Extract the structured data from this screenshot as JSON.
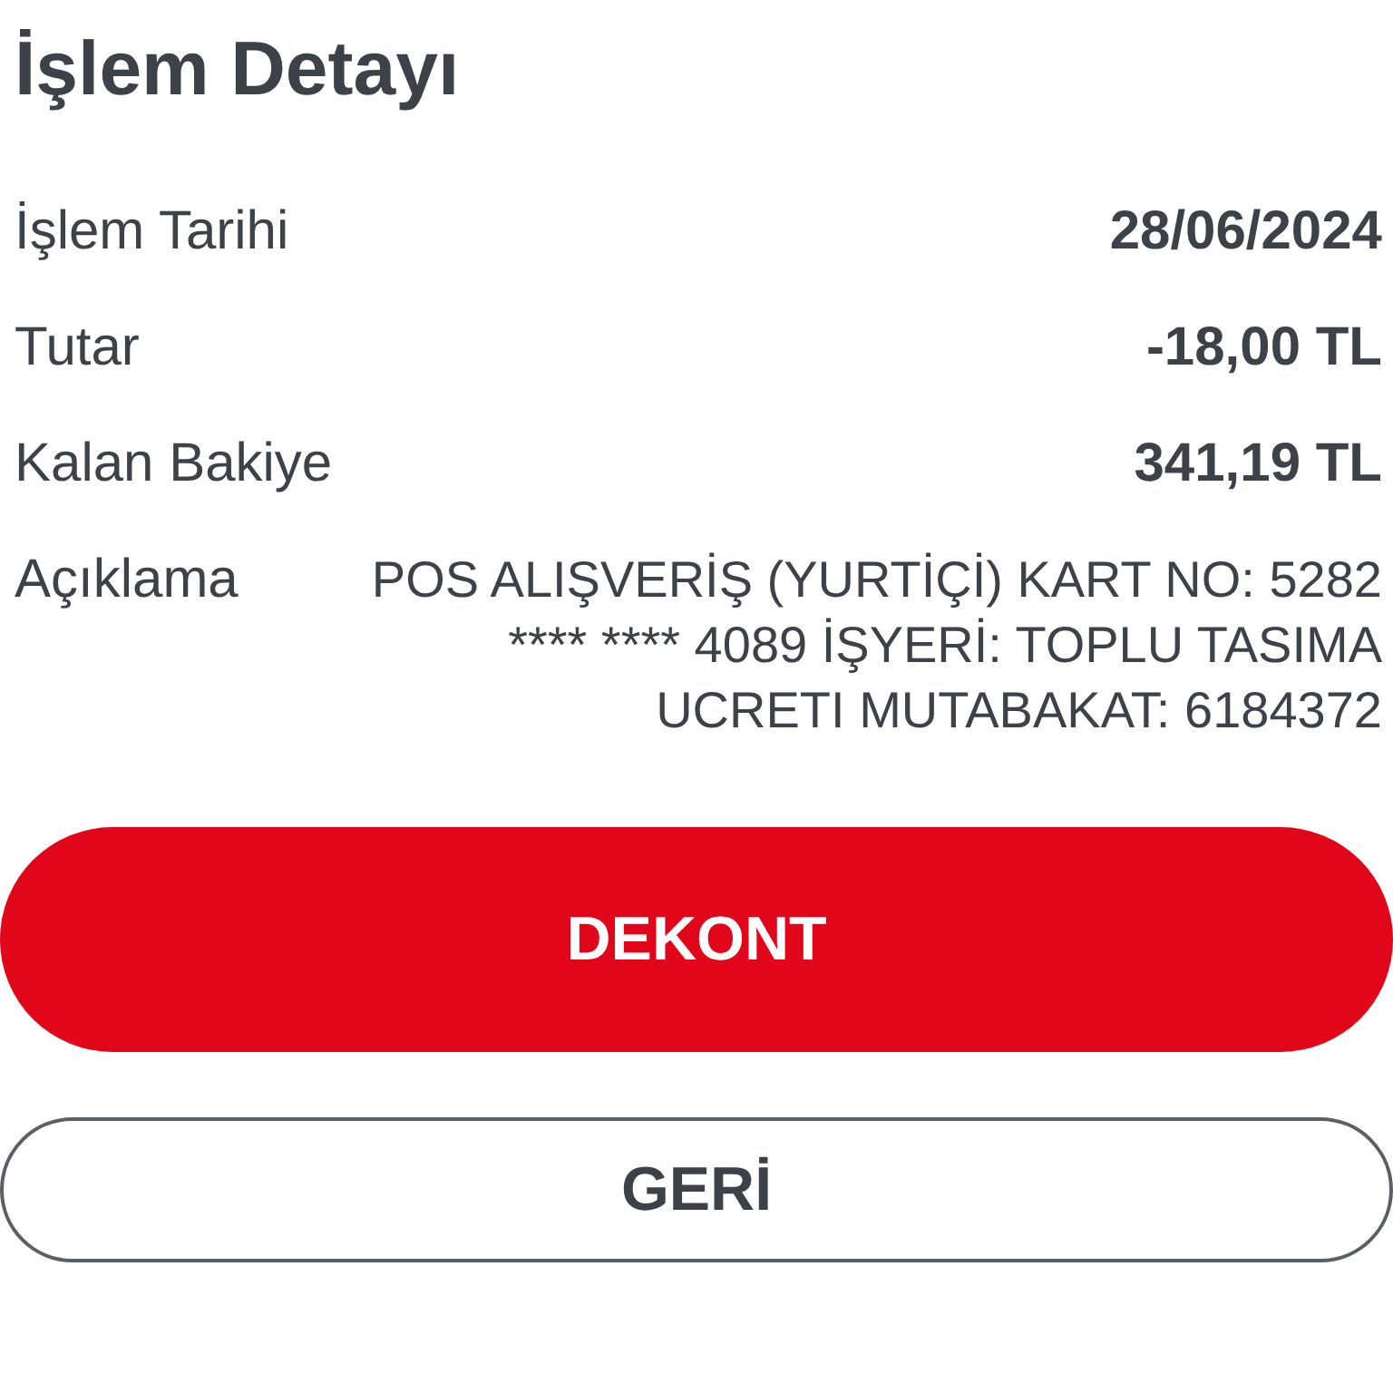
{
  "title": "İşlem Detayı",
  "details": [
    {
      "label": "İşlem Tarihi",
      "value": "28/06/2024",
      "kind": "bold"
    },
    {
      "label": "Tutar",
      "value": "-18,00 TL",
      "kind": "bold"
    },
    {
      "label": "Kalan Bakiye",
      "value": "341,19 TL",
      "kind": "bold"
    },
    {
      "label": "Açıklama",
      "value": "POS ALIŞVERİŞ (YURTİÇİ) KART NO: 5282 **** **** 4089 İŞYERİ: TOPLU TASIMA UCRETI MUTABAKAT: 6184372",
      "kind": "text"
    }
  ],
  "buttons": [
    {
      "label": "DEKONT",
      "kind": "primary"
    },
    {
      "label": "GERİ",
      "kind": "secondary"
    }
  ]
}
